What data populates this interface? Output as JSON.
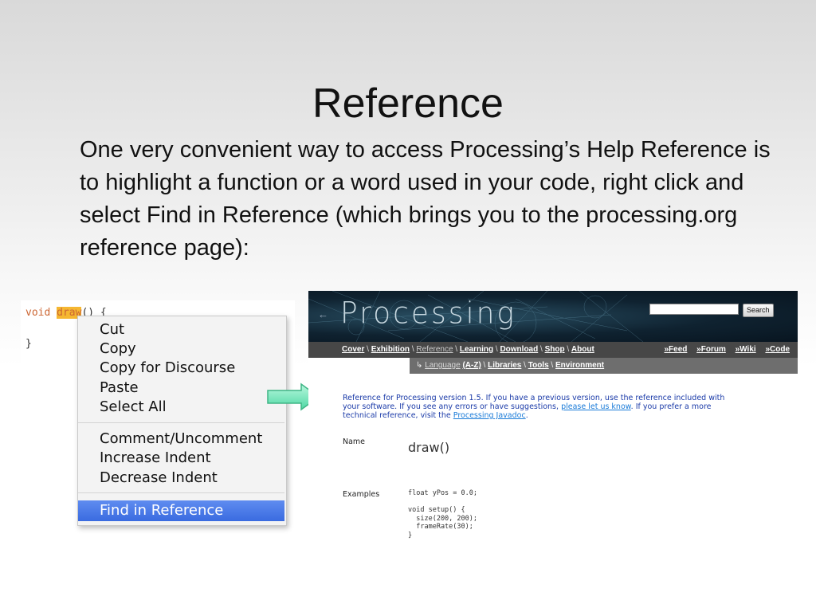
{
  "slide": {
    "title": "Reference",
    "body": "One very convenient way to access Processing’s Help Reference is to highlight a function or a word used in your code, right click and select Find in Reference (which brings you to the processing.org reference page):"
  },
  "editor": {
    "keyword": "void",
    "selected_word": "draw",
    "line1_rest": "() {",
    "line2": "}"
  },
  "context_menu": {
    "items": [
      "Cut",
      "Copy",
      "Copy for Discourse",
      "Paste",
      "Select All",
      "Comment/Uncomment",
      "Increase Indent",
      "Decrease Indent",
      "Find in Reference"
    ],
    "selected": "Find in Reference"
  },
  "arrow": {
    "color": "#7de8c0"
  },
  "website": {
    "logo": "Processing",
    "search_button": "Search",
    "nav_left": [
      "Cover",
      "Exhibition",
      "Reference",
      "Learning",
      "Download",
      "Shop",
      "About"
    ],
    "nav_right": [
      "»Feed",
      "»Forum",
      "»Wiki",
      "»Code"
    ],
    "subnav": [
      "Language",
      "(A-Z)",
      "Libraries",
      "Tools",
      "Environment"
    ],
    "intro_part1": "Reference for Processing version 1.5. If you have a previous version, use the reference included with your software. If you see any errors or have suggestions, ",
    "intro_link1": "please let us know",
    "intro_part2": ". If you prefer a more technical reference, visit the ",
    "intro_link2": "Processing Javadoc",
    "intro_part3": ".",
    "name_label": "Name",
    "function_name": "draw()",
    "examples_label": "Examples",
    "example_code": "float yPos = 0.0;\n\nvoid setup() {\n  size(200, 200);\n  frameRate(30);\n}"
  }
}
